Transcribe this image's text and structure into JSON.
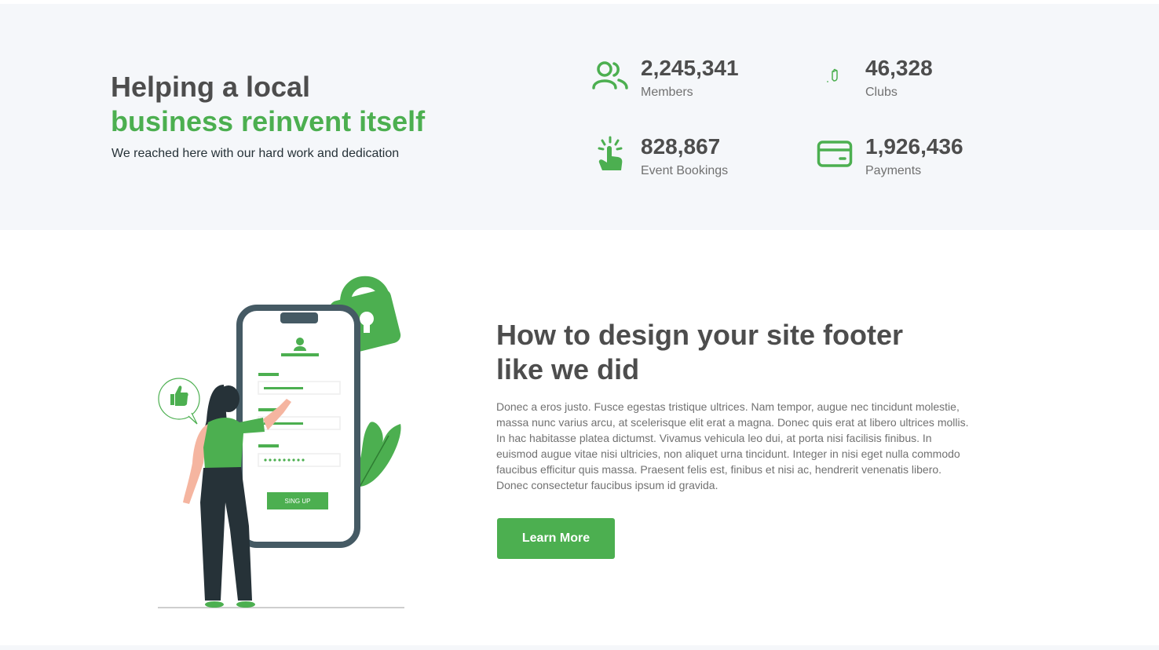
{
  "colors": {
    "brand_green": "#4caf50",
    "heading_gray": "#4d4d4d",
    "body_gray": "#717171",
    "band_bg": "#f5f7fa",
    "dark_slate": "#263238"
  },
  "hero": {
    "title_line1": "Helping a local",
    "title_line2": "business reinvent itself",
    "subtitle": "We reached here with our hard work and dedication"
  },
  "stats": [
    {
      "icon": "members-icon",
      "value": "2,245,341",
      "label": "Members"
    },
    {
      "icon": "clubs-icon",
      "value": "46,328",
      "label": "Clubs"
    },
    {
      "icon": "click-icon",
      "value": "828,867",
      "label": "Event Bookings"
    },
    {
      "icon": "card-icon",
      "value": "1,926,436",
      "label": "Payments"
    }
  ],
  "feature": {
    "title": "How to design your site footer like we did",
    "body": "Donec a eros justo. Fusce egestas tristique ultrices. Nam tempor, augue nec tincidunt molestie, massa nunc varius arcu, at scelerisque elit erat a magna. Donec quis erat at libero ultrices mollis. In hac habitasse platea dictumst. Vivamus vehicula leo dui, at porta nisi facilisis finibus. In euismod augue vitae nisi ultricies, non aliquet urna tincidunt. Integer in nisi eget nulla commodo faucibus efficitur quis massa. Praesent felis est, finibus et nisi ac, hendrerit venenatis libero. Donec consectetur faucibus ipsum id gravida.",
    "button_label": "Learn More",
    "illustration_button": "SING UP"
  }
}
